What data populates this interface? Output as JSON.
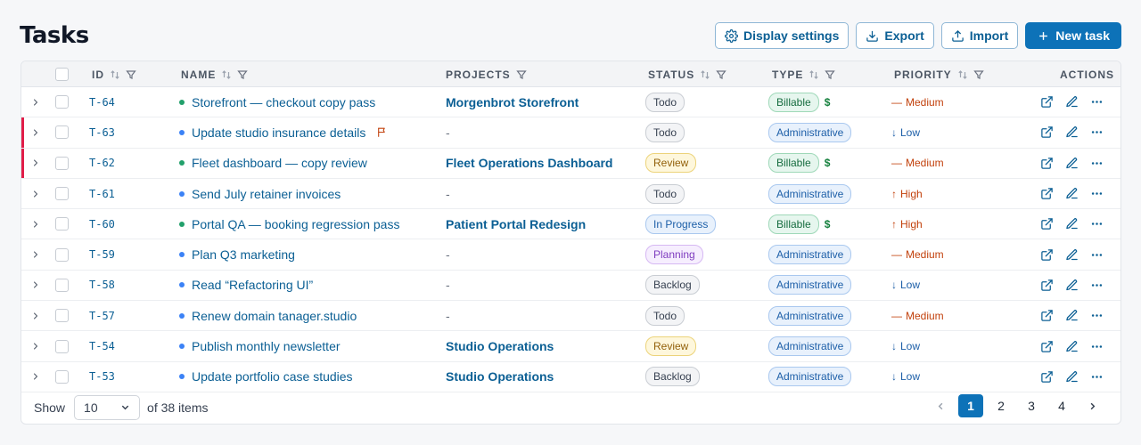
{
  "page": {
    "title": "Tasks"
  },
  "toolbar": {
    "display_settings": "Display settings",
    "export": "Export",
    "import": "Import",
    "new_task": "New task"
  },
  "columns": {
    "id": "ID",
    "name": "NAME",
    "projects": "PROJECTS",
    "status": "STATUS",
    "type": "TYPE",
    "priority": "PRIORITY",
    "actions": "ACTIONS"
  },
  "rows": [
    {
      "id": "T-64",
      "name": "Storefront — checkout copy pass",
      "dot_color": "#22a06b",
      "project": "Morgenbrot Storefront",
      "status": "Todo",
      "type": "Billable",
      "billable_mark": "$",
      "priority": "Medium",
      "priority_symbol": "—",
      "flagged": false,
      "has_flag_icon": false
    },
    {
      "id": "T-63",
      "name": "Update studio insurance details",
      "dot_color": "#3b82f6",
      "project": "-",
      "status": "Todo",
      "type": "Administrative",
      "billable_mark": "",
      "priority": "Low",
      "priority_symbol": "↓",
      "flagged": true,
      "has_flag_icon": true
    },
    {
      "id": "T-62",
      "name": "Fleet dashboard — copy review",
      "dot_color": "#22a06b",
      "project": "Fleet Operations Dashboard",
      "status": "Review",
      "type": "Billable",
      "billable_mark": "$",
      "priority": "Medium",
      "priority_symbol": "—",
      "flagged": true,
      "has_flag_icon": false
    },
    {
      "id": "T-61",
      "name": "Send July retainer invoices",
      "dot_color": "#3b82f6",
      "project": "-",
      "status": "Todo",
      "type": "Administrative",
      "billable_mark": "",
      "priority": "High",
      "priority_symbol": "↑",
      "flagged": false,
      "has_flag_icon": false
    },
    {
      "id": "T-60",
      "name": "Portal QA — booking regression pass",
      "dot_color": "#22a06b",
      "project": "Patient Portal Redesign",
      "status": "In Progress",
      "type": "Billable",
      "billable_mark": "$",
      "priority": "High",
      "priority_symbol": "↑",
      "flagged": false,
      "has_flag_icon": false
    },
    {
      "id": "T-59",
      "name": "Plan Q3 marketing",
      "dot_color": "#3b82f6",
      "project": "-",
      "status": "Planning",
      "type": "Administrative",
      "billable_mark": "",
      "priority": "Medium",
      "priority_symbol": "—",
      "flagged": false,
      "has_flag_icon": false
    },
    {
      "id": "T-58",
      "name": "Read “Refactoring UI”",
      "dot_color": "#3b82f6",
      "project": "-",
      "status": "Backlog",
      "type": "Administrative",
      "billable_mark": "",
      "priority": "Low",
      "priority_symbol": "↓",
      "flagged": false,
      "has_flag_icon": false
    },
    {
      "id": "T-57",
      "name": "Renew domain tanager.studio",
      "dot_color": "#3b82f6",
      "project": "-",
      "status": "Todo",
      "type": "Administrative",
      "billable_mark": "",
      "priority": "Medium",
      "priority_symbol": "—",
      "flagged": false,
      "has_flag_icon": false
    },
    {
      "id": "T-54",
      "name": "Publish monthly newsletter",
      "dot_color": "#3b82f6",
      "project": "Studio Operations",
      "status": "Review",
      "type": "Administrative",
      "billable_mark": "",
      "priority": "Low",
      "priority_symbol": "↓",
      "flagged": false,
      "has_flag_icon": false
    },
    {
      "id": "T-53",
      "name": "Update portfolio case studies",
      "dot_color": "#3b82f6",
      "project": "Studio Operations",
      "status": "Backlog",
      "type": "Administrative",
      "billable_mark": "",
      "priority": "Low",
      "priority_symbol": "↓",
      "flagged": false,
      "has_flag_icon": false
    }
  ],
  "status_styles": {
    "Todo": {
      "bg": "#f3f4f6",
      "border": "#c9cdd3",
      "color": "#374151"
    },
    "Review": {
      "bg": "#fef7dc",
      "border": "#ecd37a",
      "color": "#92600a"
    },
    "In Progress": {
      "bg": "#e8f1fc",
      "border": "#a9c8ef",
      "color": "#1d5fa8"
    },
    "Planning": {
      "bg": "#f6eefe",
      "border": "#d6b8f3",
      "color": "#7e3bbf"
    },
    "Backlog": {
      "bg": "#f3f4f6",
      "border": "#c9cdd3",
      "color": "#374151"
    }
  },
  "type_styles": {
    "Billable": {
      "bg": "#e6f6ee",
      "border": "#9ed8b8",
      "color": "#166c3f"
    },
    "Administrative": {
      "bg": "#e8f1fc",
      "border": "#a9c8ef",
      "color": "#1d5fa8"
    }
  },
  "priority_colors": {
    "High": "#c2410c",
    "Medium": "#c2410c",
    "Low": "#1d5fa8"
  },
  "footer": {
    "show_label": "Show",
    "page_size": "10",
    "items_text": "of 38 items",
    "pages": [
      "1",
      "2",
      "3",
      "4"
    ],
    "current_page": "1"
  },
  "colors": {
    "accent": "#0d72b8",
    "flag": "#e11d48"
  }
}
